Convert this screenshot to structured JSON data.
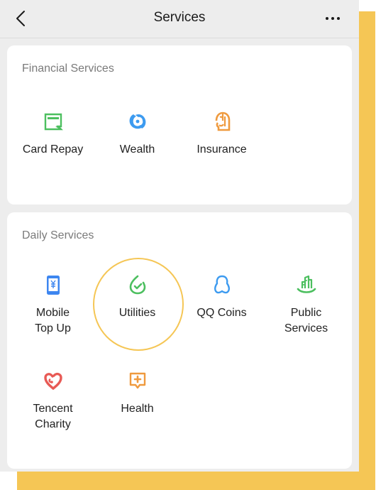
{
  "header": {
    "title": "Services",
    "back_icon": "chevron-left-icon",
    "more_icon": "more-horizontal-icon"
  },
  "sections": [
    {
      "title": "Financial Services",
      "items": [
        {
          "label": "Card Repay",
          "icon": "card-repay-icon",
          "color": "#4CBF5F"
        },
        {
          "label": "Wealth",
          "icon": "wealth-icon",
          "color": "#3D9BF0"
        },
        {
          "label": "Insurance",
          "icon": "insurance-icon",
          "color": "#EF9A3E"
        }
      ]
    },
    {
      "title": "Daily Services",
      "items": [
        {
          "label": "Mobile\nTop Up",
          "line1": "Mobile",
          "line2": "Top Up",
          "icon": "mobile-top-up-icon",
          "color": "#3D86F0"
        },
        {
          "label": "Utilities",
          "line1": "Utilities",
          "line2": "",
          "icon": "utilities-icon",
          "color": "#4CBF5F",
          "highlighted": true
        },
        {
          "label": "QQ Coins",
          "line1": "QQ Coins",
          "line2": "",
          "icon": "qq-coins-icon",
          "color": "#3D9BF0"
        },
        {
          "label": "Public\nServices",
          "line1": "Public",
          "line2": "Services",
          "icon": "public-services-icon",
          "color": "#4CBF5F"
        },
        {
          "label": "Tencent\nCharity",
          "line1": "Tencent",
          "line2": "Charity",
          "icon": "tencent-charity-icon",
          "color": "#E85A55"
        },
        {
          "label": "Health",
          "line1": "Health",
          "line2": "",
          "icon": "health-icon",
          "color": "#EF9A3E"
        }
      ]
    }
  ],
  "colors": {
    "accent_highlight": "#F5C655",
    "background": "#EDEDED",
    "card": "#FFFFFF"
  }
}
